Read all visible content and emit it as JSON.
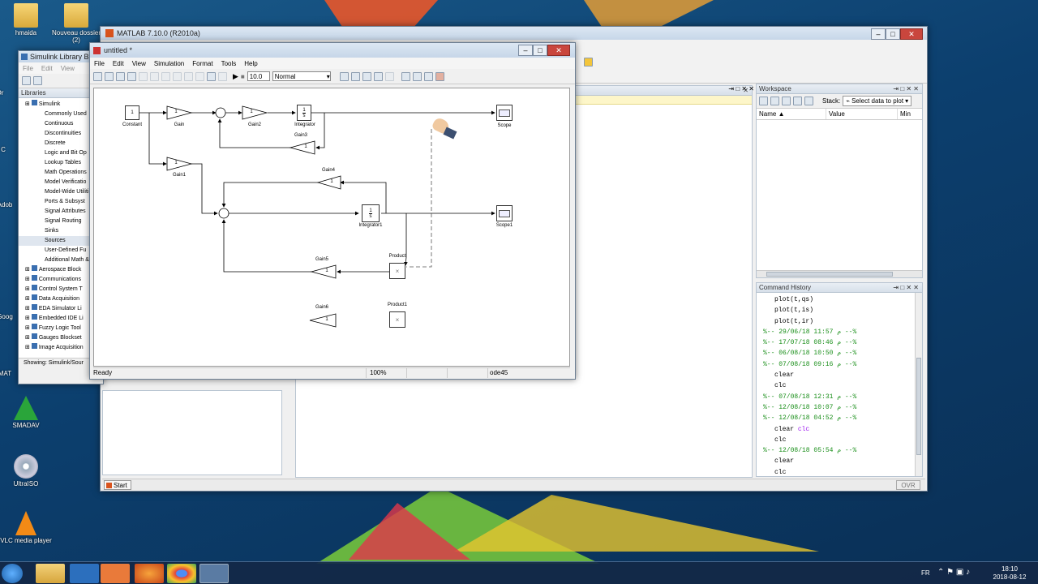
{
  "desktop": {
    "icons": [
      {
        "label": "hmaida"
      },
      {
        "label": "Nouveau dossier (2)"
      },
      {
        "label": "SMADAV"
      },
      {
        "label": "UltraISO"
      },
      {
        "label": "VLC media player"
      }
    ],
    "edge_labels": [
      "Or",
      "C",
      "Adob",
      "Goog",
      "MAT"
    ]
  },
  "matlab": {
    "title": "MATLAB 7.10.0 (R2010a)",
    "start_label": "Start",
    "status_ovr": "OVR",
    "workspace": {
      "title": "Workspace",
      "stack_label": "Stack:",
      "plot_label": "Select data to plot",
      "columns": [
        "Name ▲",
        "Value",
        "Min"
      ]
    },
    "history": {
      "title": "Command History",
      "lines": [
        {
          "type": "cmd",
          "text": "plot(t,qs)"
        },
        {
          "type": "cmd",
          "text": "plot(t,is)"
        },
        {
          "type": "cmd",
          "text": "plot(t,ir)"
        },
        {
          "type": "sep",
          "text": "%-- م 11:57  29/06/18 --%"
        },
        {
          "type": "sep",
          "text": "%-- م 08:46  17/07/18 --%"
        },
        {
          "type": "sep",
          "text": "%-- م 10:50  06/08/18 --%"
        },
        {
          "type": "sep",
          "text": "%-- م 09:16  07/08/18 --%"
        },
        {
          "type": "cmd",
          "text": "clear"
        },
        {
          "type": "cmd",
          "text": "clc"
        },
        {
          "type": "sep",
          "text": "%-- م 12:31  07/08/18 --%"
        },
        {
          "type": "sep",
          "text": "%-- م 10:07  12/08/18 --%"
        },
        {
          "type": "sep",
          "text": "%-- م 04:52  12/08/18 --%"
        },
        {
          "type": "cmd2",
          "text": "clear ",
          "extra": "clc"
        },
        {
          "type": "cmd",
          "text": "clc"
        },
        {
          "type": "sep",
          "text": "%-- م 05:54  12/08/18 --%"
        },
        {
          "type": "cmd",
          "text": "clear"
        },
        {
          "type": "cmd",
          "text": "clc"
        }
      ]
    }
  },
  "library": {
    "title": "Simulink Library Br",
    "menu": [
      "File",
      "Edit",
      "View"
    ],
    "libraries_label": "Libraries",
    "tree": [
      {
        "label": "Simulink",
        "level": 0
      },
      {
        "label": "Commonly Used",
        "level": 1
      },
      {
        "label": "Continuous",
        "level": 1
      },
      {
        "label": "Discontinuities",
        "level": 1
      },
      {
        "label": "Discrete",
        "level": 1
      },
      {
        "label": "Logic and Bit Op",
        "level": 1
      },
      {
        "label": "Lookup Tables",
        "level": 1
      },
      {
        "label": "Math Operations",
        "level": 1
      },
      {
        "label": "Model Verificatio",
        "level": 1
      },
      {
        "label": "Model-Wide Utiliti",
        "level": 1
      },
      {
        "label": "Ports & Subsyst",
        "level": 1
      },
      {
        "label": "Signal Attributes",
        "level": 1
      },
      {
        "label": "Signal Routing",
        "level": 1
      },
      {
        "label": "Sinks",
        "level": 1
      },
      {
        "label": "Sources",
        "level": 1
      },
      {
        "label": "User-Defined Fu",
        "level": 1
      },
      {
        "label": "Additional Math &",
        "level": 1
      },
      {
        "label": "Aerospace Block",
        "level": 0
      },
      {
        "label": "Communications",
        "level": 0
      },
      {
        "label": "Control System T",
        "level": 0
      },
      {
        "label": "Data Acquisition",
        "level": 0
      },
      {
        "label": "EDA Simulator Li",
        "level": 0
      },
      {
        "label": "Embedded IDE Li",
        "level": 0
      },
      {
        "label": "Fuzzy Logic Tool",
        "level": 0
      },
      {
        "label": "Gauges Blockset",
        "level": 0
      },
      {
        "label": "Image Acquisition",
        "level": 0
      }
    ],
    "status": "Showing: Simulink/Sour"
  },
  "model": {
    "title": "untitled *",
    "menu": [
      "File",
      "Edit",
      "View",
      "Simulation",
      "Format",
      "Tools",
      "Help"
    ],
    "stop_time": "10.0",
    "mode": "Normal",
    "status_ready": "Ready",
    "status_zoom": "100%",
    "status_solver": "ode45",
    "blocks": {
      "constant": {
        "text": "1",
        "label": "Constant"
      },
      "gain": {
        "text": "1",
        "label": "Gain"
      },
      "gain1": {
        "text": "1",
        "label": "Gain1"
      },
      "gain2": {
        "text": "1",
        "label": "Gain2"
      },
      "gain3": {
        "text": "1",
        "label": "Gain3"
      },
      "gain4": {
        "text": "1",
        "label": "Gain4"
      },
      "gain5": {
        "text": "1",
        "label": "Gain5"
      },
      "gain6": {
        "text": "1",
        "label": "Gain6"
      },
      "integrator": {
        "label": "Integrator"
      },
      "integrator1": {
        "label": "Integrator1"
      },
      "scope": {
        "label": "Scope"
      },
      "scope1": {
        "label": "Scope1"
      },
      "product": {
        "label": "Product"
      },
      "product1": {
        "label": "Product1"
      },
      "integ_num": "1",
      "integ_den": "s"
    }
  },
  "taskbar": {
    "lang": "FR",
    "time": "18:10",
    "date": "2018-08-12"
  },
  "colors": {
    "history_sep": "#1a8f1a",
    "keyword": "#a020f0",
    "titlebar": "#c6d6e8"
  }
}
